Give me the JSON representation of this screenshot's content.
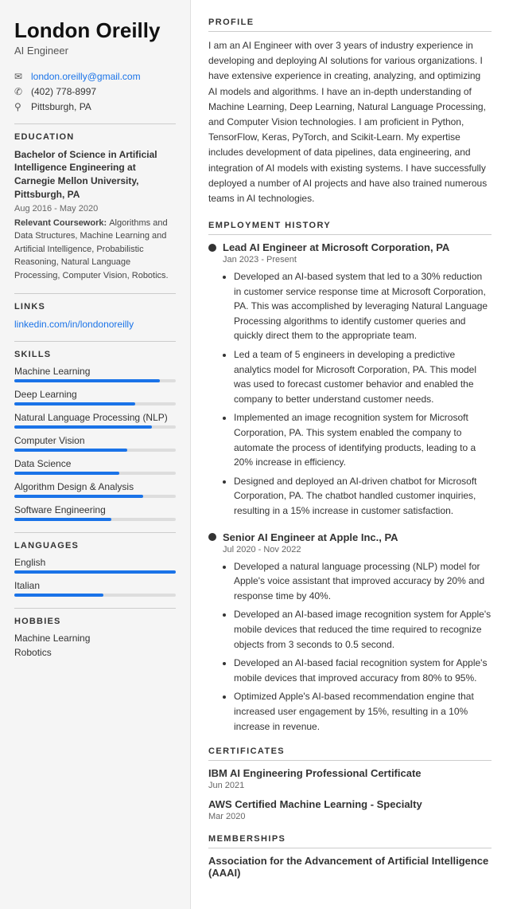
{
  "left": {
    "name": "London Oreilly",
    "title": "AI Engineer",
    "contact": {
      "email": "london.oreilly@gmail.com",
      "phone": "(402) 778-8997",
      "location": "Pittsburgh, PA"
    },
    "education": {
      "section_title": "EDUCATION",
      "degree": "Bachelor of Science in Artificial Intelligence Engineering at Carnegie Mellon University, Pittsburgh, PA",
      "dates": "Aug 2016 - May 2020",
      "coursework_label": "Relevant Coursework:",
      "coursework": "Algorithms and Data Structures, Machine Learning and Artificial Intelligence, Probabilistic Reasoning, Natural Language Processing, Computer Vision, Robotics."
    },
    "links": {
      "section_title": "LINKS",
      "url": "linkedin.com/in/londonoreilly"
    },
    "skills": {
      "section_title": "SKILLS",
      "items": [
        {
          "label": "Machine Learning",
          "pct": 90
        },
        {
          "label": "Deep Learning",
          "pct": 75
        },
        {
          "label": "Natural Language Processing (NLP)",
          "pct": 85
        },
        {
          "label": "Computer Vision",
          "pct": 70
        },
        {
          "label": "Data Science",
          "pct": 65
        },
        {
          "label": "Algorithm Design & Analysis",
          "pct": 80
        },
        {
          "label": "Software Engineering",
          "pct": 60
        }
      ]
    },
    "languages": {
      "section_title": "LANGUAGES",
      "items": [
        {
          "label": "English",
          "pct": 100
        },
        {
          "label": "Italian",
          "pct": 55
        }
      ]
    },
    "hobbies": {
      "section_title": "HOBBIES",
      "items": [
        "Machine Learning",
        "Robotics"
      ]
    }
  },
  "right": {
    "profile": {
      "section_title": "PROFILE",
      "text": "I am an AI Engineer with over 3 years of industry experience in developing and deploying AI solutions for various organizations. I have extensive experience in creating, analyzing, and optimizing AI models and algorithms. I have an in-depth understanding of Machine Learning, Deep Learning, Natural Language Processing, and Computer Vision technologies. I am proficient in Python, TensorFlow, Keras, PyTorch, and Scikit-Learn. My expertise includes development of data pipelines, data engineering, and integration of AI models with existing systems. I have successfully deployed a number of AI projects and have also trained numerous teams in AI technologies."
    },
    "employment": {
      "section_title": "EMPLOYMENT HISTORY",
      "jobs": [
        {
          "title": "Lead AI Engineer at Microsoft Corporation, PA",
          "dates": "Jan 2023 - Present",
          "bullets": [
            "Developed an AI-based system that led to a 30% reduction in customer service response time at Microsoft Corporation, PA. This was accomplished by leveraging Natural Language Processing algorithms to identify customer queries and quickly direct them to the appropriate team.",
            "Led a team of 5 engineers in developing a predictive analytics model for Microsoft Corporation, PA. This model was used to forecast customer behavior and enabled the company to better understand customer needs.",
            "Implemented an image recognition system for Microsoft Corporation, PA. This system enabled the company to automate the process of identifying products, leading to a 20% increase in efficiency.",
            "Designed and deployed an AI-driven chatbot for Microsoft Corporation, PA. The chatbot handled customer inquiries, resulting in a 15% increase in customer satisfaction."
          ]
        },
        {
          "title": "Senior AI Engineer at Apple Inc., PA",
          "dates": "Jul 2020 - Nov 2022",
          "bullets": [
            "Developed a natural language processing (NLP) model for Apple's voice assistant that improved accuracy by 20% and response time by 40%.",
            "Developed an AI-based image recognition system for Apple's mobile devices that reduced the time required to recognize objects from 3 seconds to 0.5 second.",
            "Developed an AI-based facial recognition system for Apple's mobile devices that improved accuracy from 80% to 95%.",
            "Optimized Apple's AI-based recommendation engine that increased user engagement by 15%, resulting in a 10% increase in revenue."
          ]
        }
      ]
    },
    "certificates": {
      "section_title": "CERTIFICATES",
      "items": [
        {
          "name": "IBM AI Engineering Professional Certificate",
          "date": "Jun 2021"
        },
        {
          "name": "AWS Certified Machine Learning - Specialty",
          "date": "Mar 2020"
        }
      ]
    },
    "memberships": {
      "section_title": "MEMBERSHIPS",
      "items": [
        {
          "name": "Association for the Advancement of Artificial Intelligence (AAAI)"
        }
      ]
    }
  }
}
